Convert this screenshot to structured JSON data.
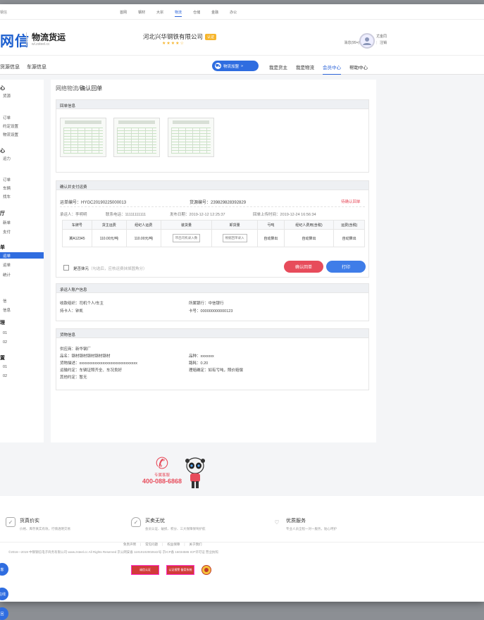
{
  "topbar": {
    "left_text": "钢信",
    "nav": [
      "首网",
      "钢材",
      "大宗",
      "物流",
      "仓储",
      "金融",
      "办公"
    ],
    "active_nav": "物流"
  },
  "header": {
    "logo": "网信",
    "brand": "物流货运",
    "domain": "wl.zsteel.cc",
    "company": "河北兴华钢铁有限公司",
    "company_badge": "认证",
    "stars": "★★★★☆",
    "user_name": "尤金同",
    "links": [
      "消息(99+)",
      "设置",
      "注销"
    ]
  },
  "navbar": {
    "left": [
      "货源信息",
      "车源信息"
    ],
    "pill": "物流加盟",
    "right": [
      "我是货主",
      "我是物流",
      "会员中心",
      "帮助中心"
    ],
    "active": "会员中心"
  },
  "sidebar": {
    "items": [
      "心",
      "货源",
      "订单",
      "约定设置",
      "物流设置",
      "心",
      "运力",
      "订单",
      "车辆",
      "找车",
      "厅",
      "新单",
      "支付",
      "单",
      "运单",
      "运单",
      "统计",
      "信",
      "信息",
      "理",
      "01",
      "02",
      "置",
      "01",
      "02"
    ],
    "active_label": "运单"
  },
  "breadcrumb": {
    "parent": "网络物流/",
    "current": "确认回单"
  },
  "receipt": {
    "title": "回单信息"
  },
  "payment": {
    "title": "确认并支付运费",
    "waybill_label": "运单编号：",
    "waybill_no": "HYGC20190225000013",
    "cargo_label": "货源编号：",
    "cargo_no": "239829828392829",
    "status": "待确认回单",
    "carrier_label": "承运人：",
    "carrier": "李明明",
    "phone_label": "联系电话：",
    "phone": "11111111111",
    "publish_label": "发布日期：",
    "publish_date": "2019-12-12 12:25:37",
    "upload_label": "回单上传时间：",
    "upload_date": "2019-12-24 16:56:34",
    "table": {
      "headers": [
        "车牌号",
        "货主运费",
        "经纪人运费",
        "装货量",
        "卸货量",
        "亏吨",
        "经纪人费用(含税)",
        "运费(含税)"
      ],
      "row": [
        "冀A12345",
        "110.00元/吨",
        "110.00元/吨",
        "带出司机录入数",
        "根据回单录入",
        "自动算出",
        "自动算出",
        "自动算出"
      ]
    },
    "checkbox_label": "是否抹元",
    "checkbox_hint": "（勾选后，应核运费抹掉圆角分）",
    "confirm_btn": "确认回单",
    "print_btn": "打印"
  },
  "account": {
    "title": "承运人账户信息",
    "org_label": "收款组织：",
    "org": "司机个人/车主",
    "holder_label": "持卡人：",
    "holder": "钟凯",
    "bank_label": "所属银行：",
    "bank": "中信银行",
    "card_label": "卡号：",
    "card": "000000000000123"
  },
  "goods": {
    "title": "货物信息",
    "supplier_label": "供应商：",
    "supplier": "新华钢厂",
    "name_label": "品名：",
    "name": "钢材钢材钢材钢材钢材",
    "desc_label": "货物描述：",
    "desc": "xxxxxxxxxxxxxxxxxxxxxxxxxxxxxx",
    "transport_label": "运输约定：",
    "transport": "车辆证照齐全、车况良好",
    "other_label": "其他约定：",
    "other": "暂无",
    "variety_label": "品种：",
    "variety": "xxxxxxx",
    "distance_label": "路耗：",
    "distance": "0.20",
    "settle_label": "理赔确定：",
    "settle": "如有亏吨，照价赔偿"
  },
  "hotline": {
    "label": "专属客服",
    "number": "400-088-6868"
  },
  "features": [
    {
      "title": "货真价实",
      "desc": "价格、库存真实有效，行情透明交易",
      "icon": "✓"
    },
    {
      "title": "买卖无忧",
      "desc": "会员认证、破损、积分、三大保障保驾护航",
      "icon": "✓"
    },
    {
      "title": "优质服务",
      "desc": "专业人员全程一对一服务，贴心呵护",
      "icon": "♡"
    }
  ],
  "footer": {
    "links": [
      "免责声明",
      "常见问题",
      "权益保障",
      "关于我们"
    ],
    "copyright": "©2016—2019   中钢钢信电子商务有限公司   www.zsteel.cc   All Rights Reserved   京公网安备 11010102002642号   京ICP备 16034586 ICP许可证   营业执照",
    "certs": [
      "诚信认证",
      "认证报警 备案系统"
    ]
  },
  "floaters": [
    "客",
    "在线",
    "回"
  ],
  "colors": {
    "accent": "#2f6de0",
    "danger": "#e74c5b"
  }
}
